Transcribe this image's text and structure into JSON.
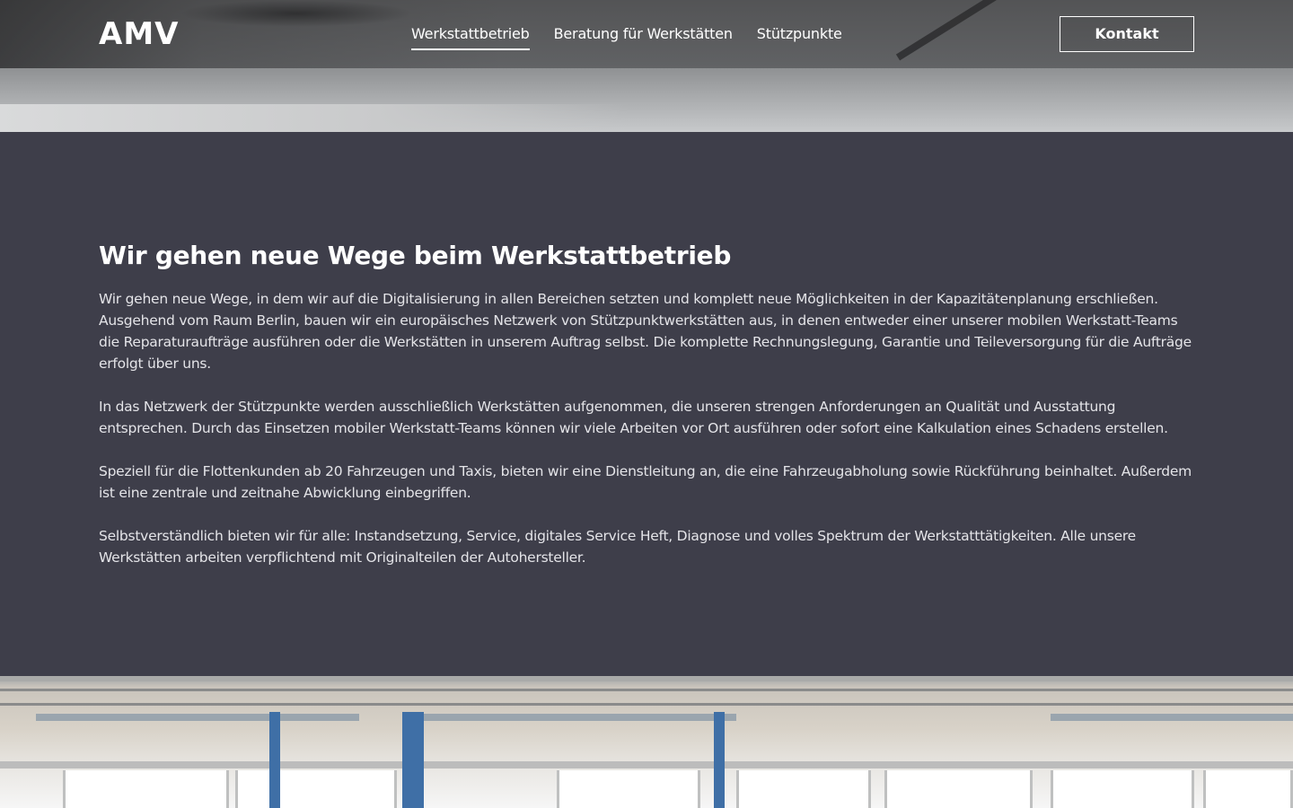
{
  "header": {
    "logo": "AMV",
    "nav": [
      {
        "label": "Werkstattbetrieb",
        "active": true
      },
      {
        "label": "Beratung für Werkstätten",
        "active": false
      },
      {
        "label": "Stützpunkte",
        "active": false
      }
    ],
    "contact_label": "Kontakt"
  },
  "main": {
    "title": "Wir gehen neue Wege beim Werkstattbetrieb",
    "paragraphs": [
      "Wir gehen neue Wege, in dem wir auf die Digitalisierung in allen Bereichen setzten und komplett neue Möglichkeiten in der Kapazitätenplanung erschließen. Ausgehend vom Raum Berlin, bauen wir ein europäisches Netzwerk von Stützpunktwerkstätten aus, in denen entweder einer unserer mobilen Werkstatt-Teams die Reparaturaufträge ausführen oder die Werkstätten in unserem Auftrag selbst. Die komplette Rechnungslegung, Garantie und Teileversorgung für die Aufträge erfolgt über uns.",
      "In das Netzwerk der Stützpunkte werden ausschließlich Werkstätten aufgenommen, die unseren strengen Anforderungen an Qualität und Ausstattung entsprechen. Durch das Einsetzen mobiler Werkstatt-Teams können wir viele Arbeiten vor Ort ausführen oder sofort eine Kalkulation eines Schadens erstellen.",
      "Speziell für die Flottenkunden ab 20 Fahrzeugen und Taxis, bieten wir eine Dienstleitung an, die eine Fahrzeugabholung sowie Rückführung beinhaltet. Außerdem ist eine zentrale und zeitnahe Abwicklung einbegriffen.",
      "Selbstverständlich bieten wir für alle: Instandsetzung, Service, digitales Service Heft, Diagnose und volles Spektrum der Werkstatttätigkeiten. Alle unsere Werkstätten arbeiten verpflichtend mit Originalteilen der Autohersteller."
    ]
  },
  "colors": {
    "content_bg": "#3e3e4a",
    "text": "#e4e4e8",
    "heading": "#ffffff"
  }
}
